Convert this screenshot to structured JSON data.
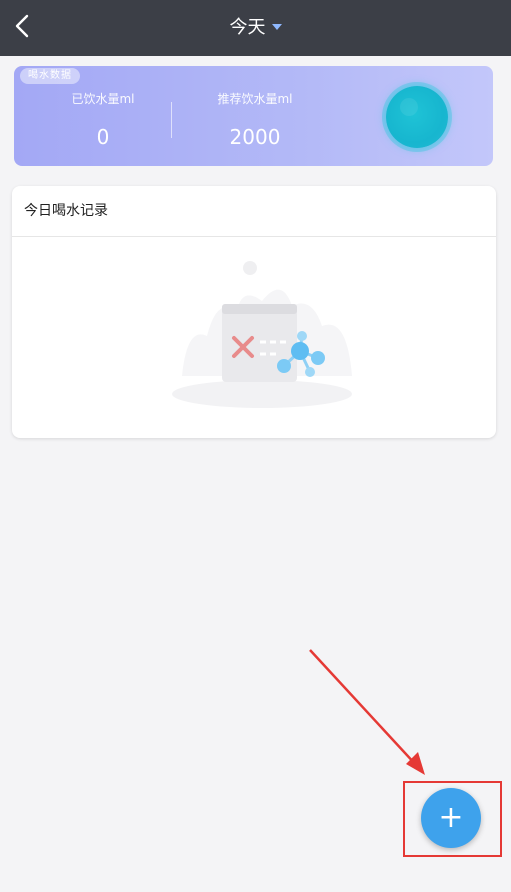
{
  "header": {
    "title": "今天",
    "back_icon": "chevron-left-icon",
    "dropdown_icon": "caret-down-icon"
  },
  "summary": {
    "tag": "喝水数据",
    "drank_label": "已饮水量ml",
    "drank_value": "0",
    "recommended_label": "推荐饮水量ml",
    "recommended_value": "2000",
    "progress_icon": "water-level-orb"
  },
  "records": {
    "title": "今日喝水记录",
    "empty_icon": "empty-state-illustration"
  },
  "fab": {
    "label": "+",
    "icon": "plus-icon"
  },
  "annotation": {
    "color": "#e53935"
  },
  "colors": {
    "topbar": "#3c3f47",
    "accent": "#3ea2ec",
    "card": "#a3a8f5",
    "orb": "#17b6cf"
  }
}
